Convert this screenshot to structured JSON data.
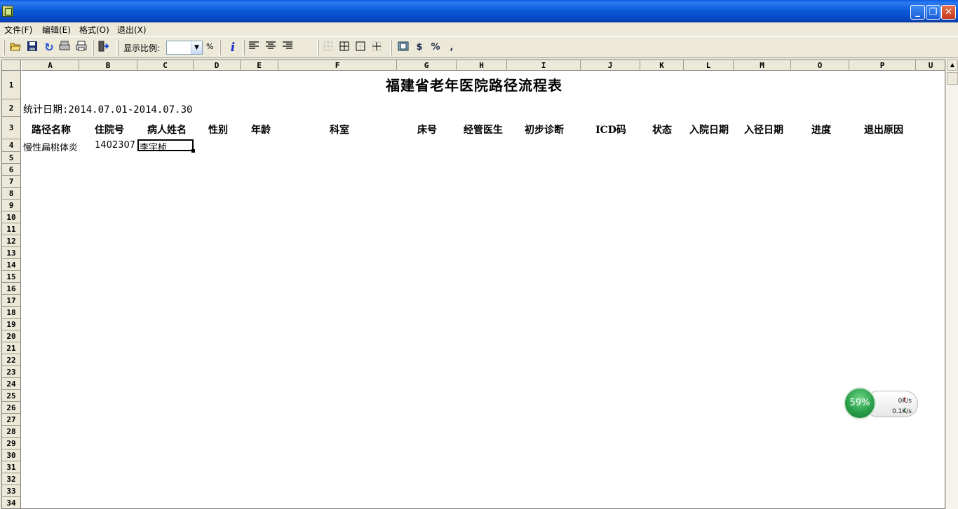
{
  "window": {
    "title": "",
    "controls": {
      "minimize": "_",
      "restore": "❐",
      "close": "✕"
    }
  },
  "menu": [
    {
      "label": "文件(F)"
    },
    {
      "label": "编辑(E)"
    },
    {
      "label": "格式(O)"
    },
    {
      "label": "退出(X)"
    }
  ],
  "toolbar": {
    "zoom_label": "显示比例:",
    "zoom_value": "",
    "percent_label": "%",
    "icons": [
      "open-icon",
      "save-icon",
      "refresh-icon",
      "print-preview-icon",
      "print-icon",
      "exit-icon",
      "info-icon",
      "align-left-icon",
      "align-center-icon",
      "align-right-icon",
      "no-border-icon",
      "all-borders-icon",
      "outer-border-icon",
      "inner-border-icon",
      "format-icon",
      "currency-icon",
      "percent-icon",
      "comma-icon"
    ]
  },
  "sheet": {
    "columns": [
      "A",
      "B",
      "C",
      "D",
      "E",
      "F",
      "G",
      "H",
      "I",
      "J",
      "K",
      "L",
      "M",
      "O",
      "P",
      "U"
    ],
    "rows": [
      "1",
      "2",
      "3",
      "4",
      "5",
      "6",
      "7",
      "8",
      "9",
      "10",
      "11",
      "12",
      "13",
      "14",
      "15",
      "16",
      "17",
      "18",
      "19",
      "20",
      "21",
      "22",
      "23",
      "24",
      "25",
      "26",
      "27",
      "28",
      "29",
      "30",
      "31",
      "32",
      "33",
      "34"
    ],
    "title": "福建省老年医院路径流程表",
    "stat_date": "统计日期:2014.07.01-2014.07.30",
    "headers": [
      "路径名称",
      "住院号",
      "病人姓名",
      "性别",
      "年龄",
      "科室",
      "床号",
      "经管医生",
      "初步诊断",
      "ICD码",
      "状态",
      "入院日期",
      "入径日期",
      "进度",
      "退出原因"
    ],
    "rows_data": [
      {
        "path_name": "慢性扁桃体炎",
        "admission_no": "1402307",
        "patient_name": "李宇桢"
      }
    ]
  },
  "net_widget": {
    "percent": "59%",
    "upload": "0K/s",
    "download": "0.1K/s"
  }
}
